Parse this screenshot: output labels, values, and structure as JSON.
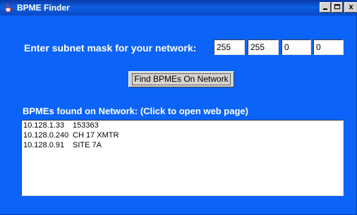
{
  "window": {
    "title": "BPME Finder",
    "colors": {
      "background": "#0b63f7",
      "titlebar": "#0d5fe0",
      "text": "#ffffff"
    },
    "icons": [
      "java-cup-icon",
      "minimize-icon",
      "maximize-icon",
      "close-icon"
    ],
    "close_label": "x"
  },
  "subnet": {
    "prompt": "Enter subnet mask for your network:",
    "octets": [
      "255",
      "255",
      "0",
      "0"
    ]
  },
  "find_button": {
    "label": "Find BPMEs On Network"
  },
  "results": {
    "label": "BPMEs found on Network: (Click to open web page)",
    "rows": [
      {
        "ip": "10.128.1.33",
        "name": "153363"
      },
      {
        "ip": "10.128.0.240",
        "name": "CH 17 XMTR"
      },
      {
        "ip": "10.128.0.91",
        "name": "SITE 7A"
      }
    ]
  }
}
